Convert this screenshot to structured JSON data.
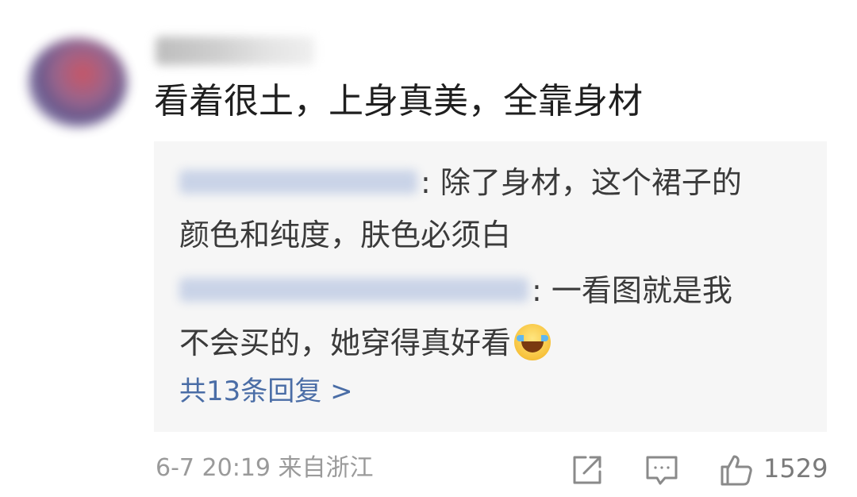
{
  "comment": {
    "text": "看着很土，上身真美，全靠身材"
  },
  "replies": {
    "reply1": {
      "line1": ": 除了身材，这个裙子的",
      "line2": "颜色和纯度，肤色必须白"
    },
    "reply2": {
      "line1": ": 一看图就是我",
      "line2": "不会买的，她穿得真好看"
    },
    "more_link": "共13条回复 >"
  },
  "footer": {
    "timestamp": "6-7 20:19 来自浙江",
    "like_count": "1529",
    "icons": [
      "share-icon",
      "comment-icon",
      "like-icon"
    ]
  },
  "colors": {
    "link": "#4a6da6",
    "reply_bg": "#f6f6f6",
    "text_main": "#1f1f1f",
    "text_meta": "#9a9a9a"
  }
}
